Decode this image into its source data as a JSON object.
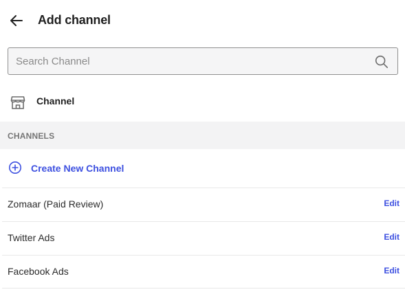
{
  "header": {
    "title": "Add channel",
    "back_icon": "arrow-left-icon"
  },
  "search": {
    "placeholder": "Search Channel",
    "value": "",
    "icon": "search-icon"
  },
  "channel_section": {
    "label": "Channel",
    "icon": "store-icon"
  },
  "channels_header": {
    "label": "CHANNELS"
  },
  "create_new": {
    "label": "Create New Channel",
    "icon": "plus-circle-icon"
  },
  "channels": [
    {
      "name": "Zomaar (Paid Review)",
      "edit_label": "Edit"
    },
    {
      "name": "Twitter Ads",
      "edit_label": "Edit"
    },
    {
      "name": "Facebook Ads",
      "edit_label": "Edit"
    }
  ],
  "colors": {
    "accent": "#3c4fe0",
    "section_bg": "#f3f3f4",
    "text": "#1f1f1f"
  }
}
